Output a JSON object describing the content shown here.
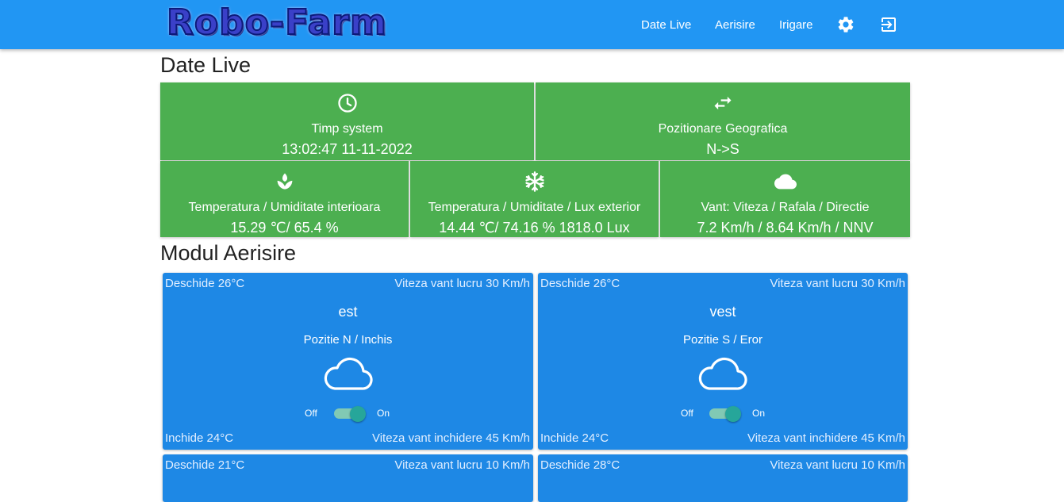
{
  "header": {
    "logo": "Robo-Farm",
    "nav": [
      "Date Live",
      "Aerisire",
      "Irigare"
    ],
    "icons": [
      "settings-icon",
      "logout-icon"
    ]
  },
  "live": {
    "title": "Date Live",
    "tiles": [
      {
        "icon": "clock-icon",
        "label": "Timp system",
        "value": "13:02:47 11-11-2022"
      },
      {
        "icon": "swap-arrows-icon",
        "label": "Pozitionare Geografica",
        "value": "N->S"
      },
      {
        "icon": "sprout-icon",
        "label": "Temperatura / Umiditate interioara",
        "value": "15.29 ℃/ 65.4 %"
      },
      {
        "icon": "snowflake-icon",
        "label": "Temperatura / Umiditate / Lux exterior",
        "value": "14.44 ℃/ 74.16 % 1818.0 Lux"
      },
      {
        "icon": "cloud-icon",
        "label": "Vant: Viteza / Rafala / Directie",
        "value": "7.2 Km/h / 8.64 Km/h / NNV"
      }
    ]
  },
  "aerisire": {
    "title": "Modul Aerisire",
    "cards": [
      {
        "open": "Deschide 26°C",
        "wind_work": "Viteza vant lucru 30 Km/h",
        "name": "est",
        "position": "Pozitie N / Inchis",
        "off": "Off",
        "on": "On",
        "close": "Inchide 24°C",
        "wind_close": "Viteza vant inchidere 45 Km/h"
      },
      {
        "open": "Deschide 26°C",
        "wind_work": "Viteza vant lucru 30 Km/h",
        "name": "vest",
        "position": "Pozitie S / Eror",
        "off": "Off",
        "on": "On",
        "close": "Inchide 24°C",
        "wind_close": "Viteza vant inchidere 45 Km/h"
      },
      {
        "open": "Deschide 21°C",
        "wind_work": "Viteza vant lucru 10 Km/h"
      },
      {
        "open": "Deschide 28°C",
        "wind_work": "Viteza vant lucru 10 Km/h"
      }
    ]
  },
  "colors": {
    "header": "#2196f3",
    "tile": "#4caf50",
    "card": "#1e88e5",
    "toggle": "#26a69a"
  }
}
